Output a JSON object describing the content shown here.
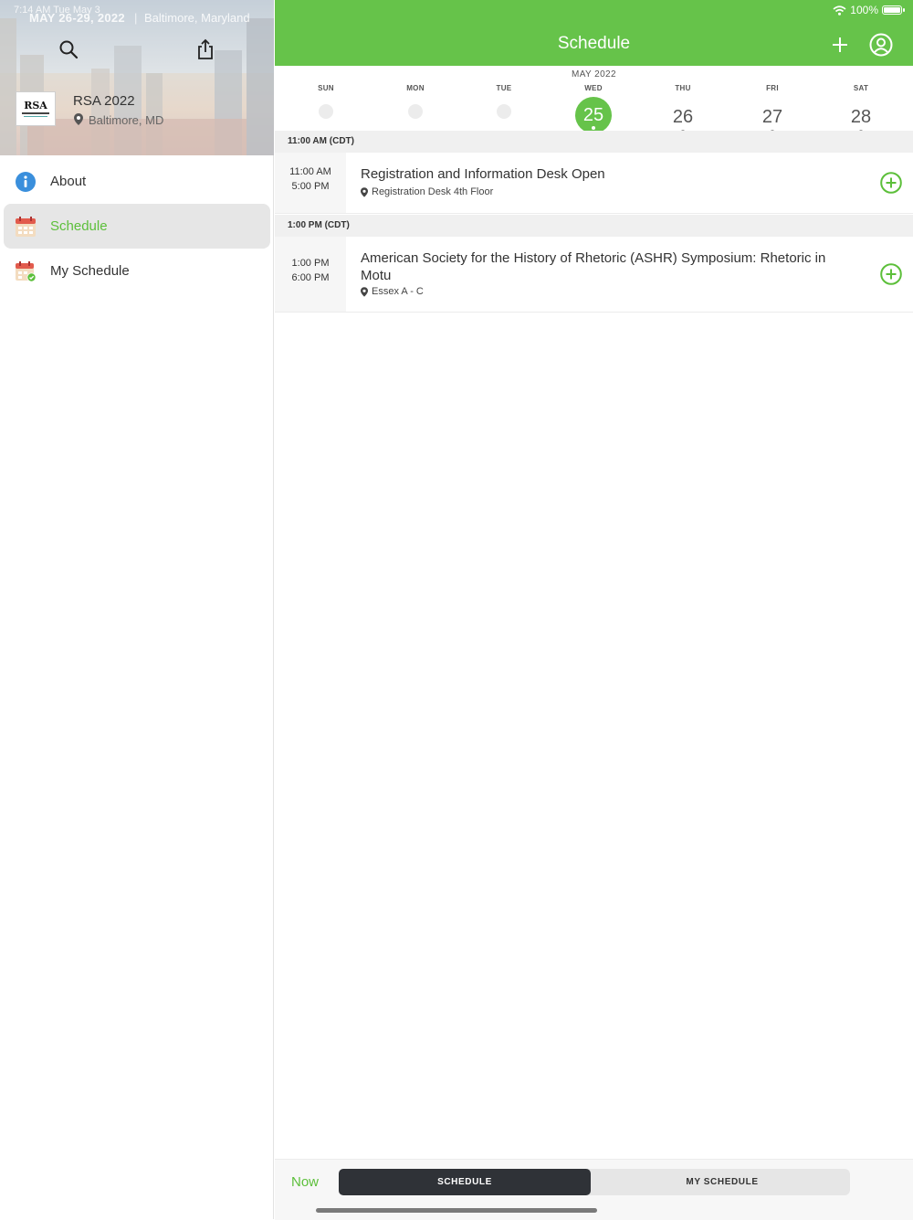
{
  "status": {
    "time": "7:14 AM  Tue May 3",
    "battery": "100%"
  },
  "sidebar": {
    "hero": {
      "dates": "MAY 26-29, 2022",
      "separator": "|",
      "location": "Baltimore, Maryland"
    },
    "event": {
      "logo_text": "RSA",
      "name": "RSA 2022",
      "city": "Baltimore, MD"
    },
    "items": [
      {
        "label": "About",
        "icon": "info-icon",
        "active": false
      },
      {
        "label": "Schedule",
        "icon": "calendar-icon",
        "active": true
      },
      {
        "label": "My Schedule",
        "icon": "calendar-check-icon",
        "active": false
      }
    ]
  },
  "header": {
    "title": "Schedule"
  },
  "week": {
    "month": "MAY 2022",
    "days": [
      {
        "dow": "SUN",
        "num": "",
        "selected": false,
        "has_events": false
      },
      {
        "dow": "MON",
        "num": "",
        "selected": false,
        "has_events": false
      },
      {
        "dow": "TUE",
        "num": "",
        "selected": false,
        "has_events": false
      },
      {
        "dow": "WED",
        "num": "25",
        "selected": true,
        "has_events": true
      },
      {
        "dow": "THU",
        "num": "26",
        "selected": false,
        "has_events": true
      },
      {
        "dow": "FRI",
        "num": "27",
        "selected": false,
        "has_events": true
      },
      {
        "dow": "SAT",
        "num": "28",
        "selected": false,
        "has_events": true
      }
    ]
  },
  "sections": [
    {
      "header": "11:00 AM (CDT)",
      "sessions": [
        {
          "start": "11:00 AM",
          "end": "5:00 PM",
          "title": "Registration and Information Desk Open",
          "location": "Registration Desk 4th Floor"
        }
      ]
    },
    {
      "header": "1:00 PM (CDT)",
      "sessions": [
        {
          "start": "1:00 PM",
          "end": "6:00 PM",
          "title": "American Society for the History of Rhetoric (ASHR) Symposium: Rhetoric in Motu",
          "location": "Essex A - C"
        }
      ]
    }
  ],
  "bottom": {
    "now": "Now",
    "tab_schedule": "SCHEDULE",
    "tab_my_schedule": "MY SCHEDULE"
  },
  "colors": {
    "accent": "#66c34a",
    "accent_text": "#5cbf3a",
    "segment_active": "#2f3237"
  }
}
